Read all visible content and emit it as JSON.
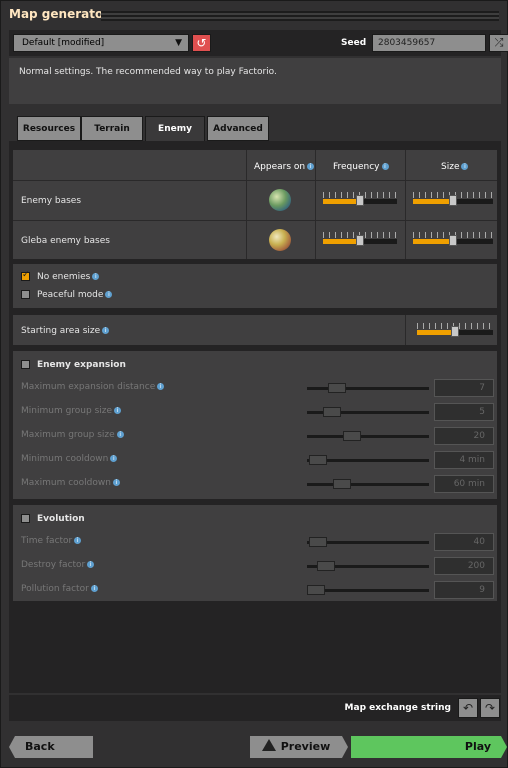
{
  "window": {
    "title": "Map generator"
  },
  "preset": {
    "value": "Default [modified]"
  },
  "seed": {
    "label": "Seed",
    "value": "2803459657"
  },
  "description": "Normal settings. The recommended way to play Factorio.",
  "tabs": [
    {
      "label": "Resources",
      "active": false
    },
    {
      "label": "Terrain",
      "active": false
    },
    {
      "label": "Enemy",
      "active": true
    },
    {
      "label": "Advanced",
      "active": false
    }
  ],
  "table": {
    "headers": {
      "appears_on": "Appears on",
      "frequency": "Frequency",
      "size": "Size"
    },
    "rows": [
      {
        "label": "Enemy bases",
        "planet": "nauvis-planet-icon",
        "frequency": 0.5,
        "size": 0.5
      },
      {
        "label": "Gleba enemy bases",
        "planet": "gleba-planet-icon",
        "frequency": 0.5,
        "size": 0.5
      }
    ]
  },
  "options": {
    "no_enemies": {
      "label": "No enemies",
      "checked": true
    },
    "peaceful_mode": {
      "label": "Peaceful mode",
      "checked": false
    }
  },
  "starting_area": {
    "label": "Starting area size",
    "value": 0.5
  },
  "expansion": {
    "title": "Enemy expansion",
    "enabled": false,
    "rows": [
      {
        "label": "Maximum expansion distance",
        "value": "7",
        "level": 0.2
      },
      {
        "label": "Minimum group size",
        "value": "5",
        "level": 0.15
      },
      {
        "label": "Maximum group size",
        "value": "20",
        "level": 0.35
      },
      {
        "label": "Minimum cooldown",
        "value": "4 min",
        "level": 0.02
      },
      {
        "label": "Maximum cooldown",
        "value": "60 min",
        "level": 0.25
      }
    ]
  },
  "evolution": {
    "title": "Evolution",
    "enabled": false,
    "rows": [
      {
        "label": "Time factor",
        "value": "40",
        "level": 0.02
      },
      {
        "label": "Destroy factor",
        "value": "200",
        "level": 0.1
      },
      {
        "label": "Pollution factor",
        "value": "9",
        "level": 0.0
      }
    ]
  },
  "footer": {
    "exchange_label": "Map exchange string"
  },
  "buttons": {
    "back": "Back",
    "preview": "Preview",
    "play": "Play"
  },
  "colors": {
    "accent": "#f0a000",
    "play": "#5ec65e",
    "reset": "#e05050"
  }
}
